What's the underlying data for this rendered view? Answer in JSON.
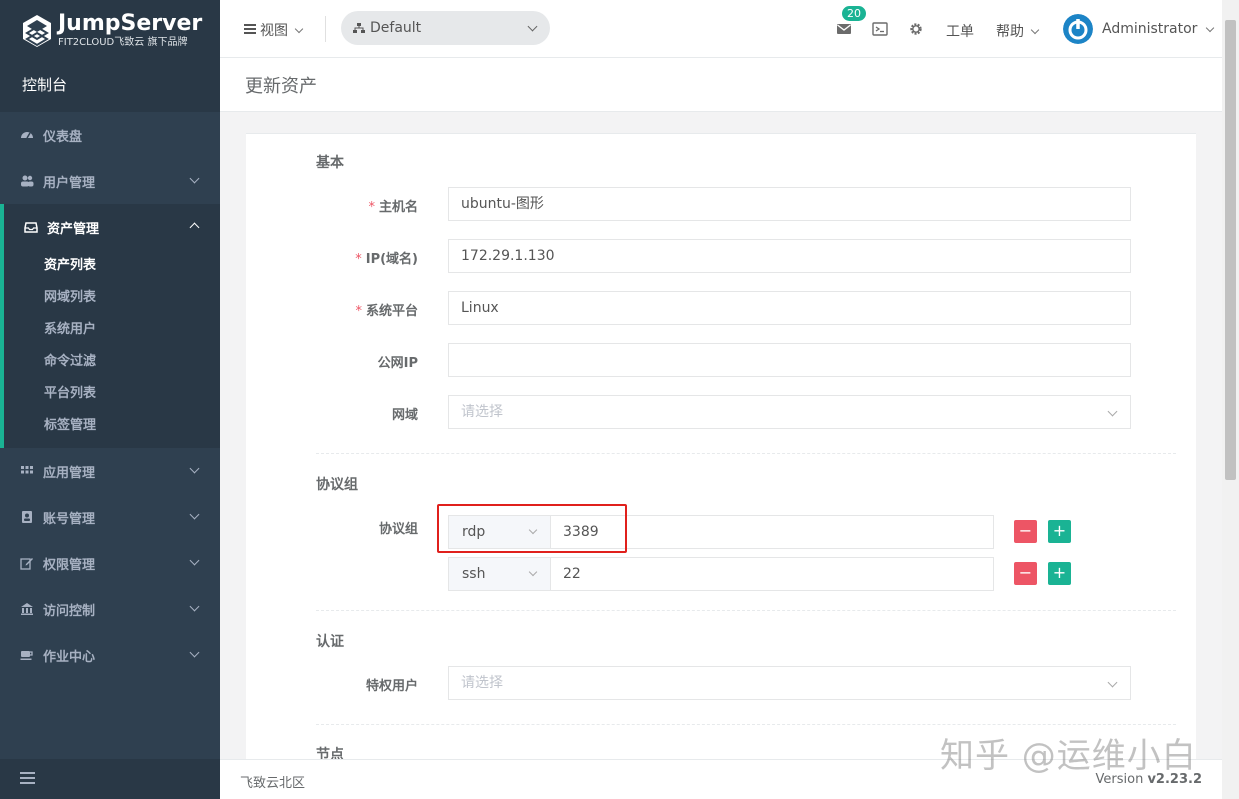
{
  "brand": {
    "name": "JumpServer",
    "tagline": "FIT2CLOUD飞致云 旗下品牌",
    "console": "控制台"
  },
  "sidebar": {
    "items": [
      {
        "label": "仪表盘",
        "icon": "dashboard-icon"
      },
      {
        "label": "用户管理",
        "icon": "users-icon"
      },
      {
        "label": "资产管理",
        "icon": "inbox-icon",
        "expanded": true
      },
      {
        "label": "应用管理",
        "icon": "grid-icon"
      },
      {
        "label": "账号管理",
        "icon": "address-book-icon"
      },
      {
        "label": "权限管理",
        "icon": "edit-icon"
      },
      {
        "label": "访问控制",
        "icon": "building-icon"
      },
      {
        "label": "作业中心",
        "icon": "coffee-icon"
      }
    ],
    "asset_sub": [
      "资产列表",
      "网域列表",
      "系统用户",
      "命令过滤",
      "平台列表",
      "标签管理"
    ]
  },
  "topbar": {
    "view": "视图",
    "org": "Default",
    "badge": "20",
    "ticket": "工单",
    "help": "帮助",
    "user": "Administrator"
  },
  "page": {
    "title": "更新资产"
  },
  "form": {
    "basic_title": "基本",
    "hostname_label": "主机名",
    "hostname": "ubuntu-图形",
    "ip_label": "IP(域名)",
    "ip": "172.29.1.130",
    "platform_label": "系统平台",
    "platform": "Linux",
    "public_ip_label": "公网IP",
    "public_ip": "",
    "domain_label": "网域",
    "domain_placeholder": "请选择",
    "protocol_title": "协议组",
    "protocol_label": "协议组",
    "protocols": [
      {
        "name": "rdp",
        "port": "3389"
      },
      {
        "name": "ssh",
        "port": "22"
      }
    ],
    "auth_title": "认证",
    "admin_user_label": "特权用户",
    "admin_user_placeholder": "请选择",
    "node_title": "节点"
  },
  "footer": {
    "left": "飞致云北区",
    "version_prefix": "Version",
    "version": "v2.23.2"
  },
  "watermark": "知乎 @运维小白",
  "colors": {
    "sidebar": "#2f4050",
    "accent": "#1ab394",
    "danger": "#ed5565",
    "highlight": "#e0201c"
  }
}
